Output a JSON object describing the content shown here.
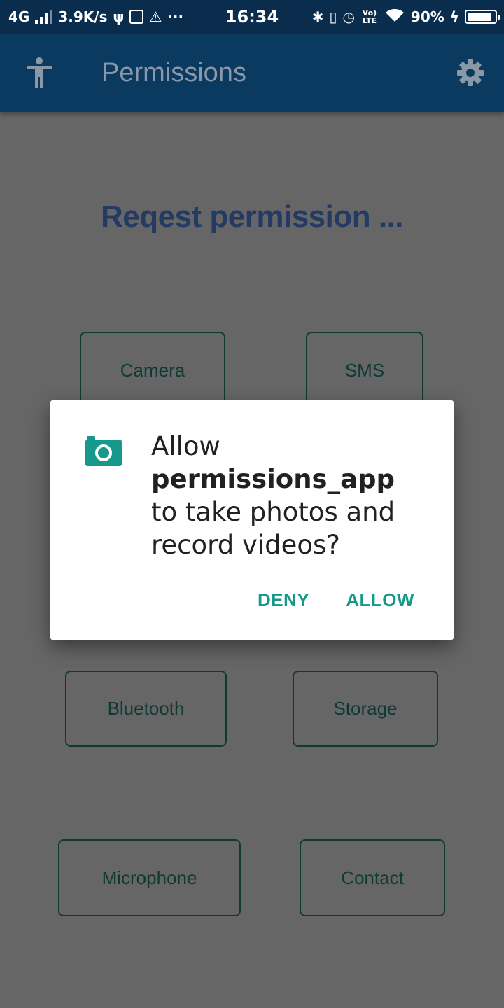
{
  "status_bar": {
    "network": "4G",
    "speed": "3.9K/s",
    "time": "16:34",
    "volte": "Vo) LTE",
    "battery_pct": "90%",
    "battery_level": 0.9
  },
  "app_bar": {
    "title": "Permissions",
    "left_icon": "accessibility-icon",
    "right_icon": "gear-icon"
  },
  "main": {
    "heading": "Reqest permission ...",
    "buttons": {
      "camera": "Camera",
      "sms": "SMS",
      "bluetooth": "Bluetooth",
      "storage": "Storage",
      "microphone": "Microphone",
      "contact": "Contact"
    }
  },
  "dialog": {
    "icon": "camera-icon",
    "line1": "Allow",
    "app_name": "permissions_app",
    "line2": "to take photos and",
    "line3": "record videos?",
    "deny_label": "DENY",
    "allow_label": "ALLOW",
    "accent_color": "#16998a"
  },
  "colors": {
    "status_bar": "#0b2d4d",
    "app_bar": "#0b3a60",
    "scrim_background": "#666666",
    "heading": "#223a64"
  }
}
